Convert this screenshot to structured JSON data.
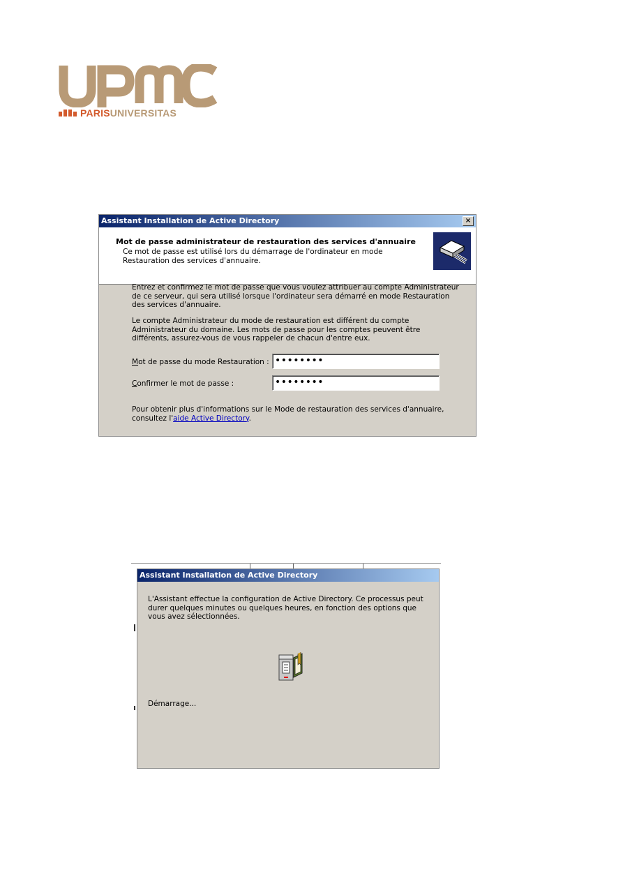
{
  "logo": {
    "letters": "UPMC",
    "sub_paris": "PARIS",
    "sub_universitas": "UNIVERSITAS",
    "colors": {
      "tan": "#b89a76",
      "orange": "#d35a2c"
    }
  },
  "dialog1": {
    "title": "Assistant Installation de Active Directory",
    "close_glyph": "×",
    "header_title": "Mot de passe administrateur de restauration des services d'annuaire",
    "header_sub": "Ce mot de passe est utilisé lors du démarrage de l'ordinateur en mode Restauration des services d'annuaire.",
    "header_icon": "wizard-book-icon",
    "para1": "Entrez et confirmez le mot de passe que vous voulez attribuer au compte Administrateur de ce serveur, qui sera utilisé lorsque l'ordinateur sera démarré en mode Restauration des services d'annuaire.",
    "para2": "Le compte Administrateur du mode de restauration est différent du compte Administrateur du domaine. Les mots de passe pour les comptes peuvent être différents, assurez-vous de vous rappeler de chacun d'entre eux.",
    "field1_accel": "M",
    "field1_rest": "ot de passe du mode Restauration :",
    "field1_value": "••••••••",
    "field2_accel": "C",
    "field2_rest": "onfirmer le mot de passe :",
    "field2_value": "••••••••",
    "info_line1": "Pour obtenir plus d'informations sur le Mode de restauration des services d'annuaire,",
    "info_prefix": "consultez l'",
    "info_link": "aide Active Directory",
    "info_suffix": "."
  },
  "dialog2": {
    "title": "Assistant Installation de Active Directory",
    "message": "L'Assistant effectue la configuration de Active Directory. Ce processus peut durer quelques minutes ou quelques heures, en fonction des options que vous avez sélectionnées.",
    "status": "Démarrage...",
    "icon": "directory-book-icon"
  }
}
